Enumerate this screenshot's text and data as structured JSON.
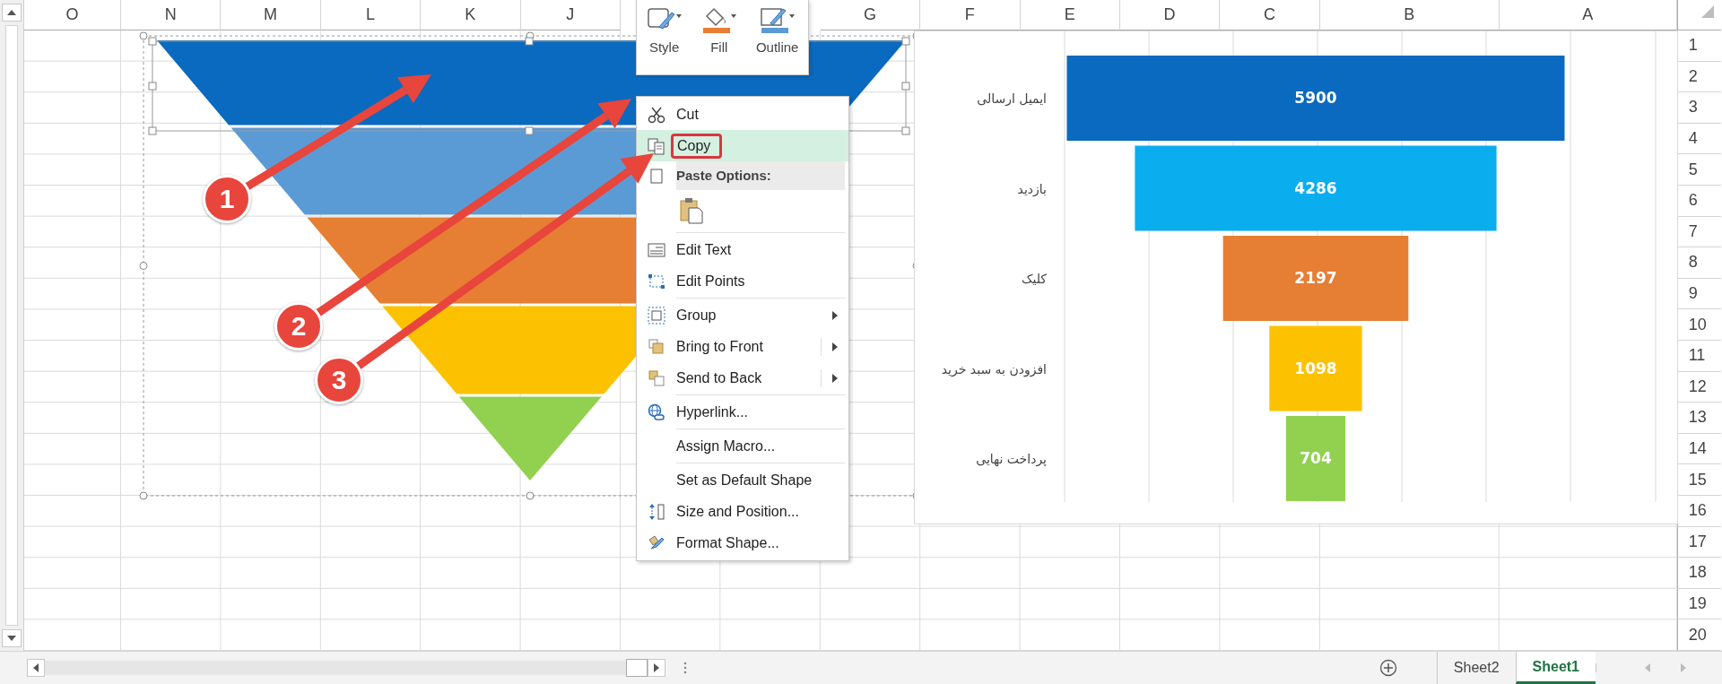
{
  "column_headers": [
    "O",
    "N",
    "M",
    "L",
    "K",
    "J",
    "G",
    "F",
    "E",
    "D",
    "C",
    "B",
    "A"
  ],
  "row_headers": [
    "1",
    "2",
    "3",
    "4",
    "5",
    "6",
    "7",
    "8",
    "9",
    "10",
    "11",
    "12",
    "13",
    "14",
    "15",
    "16",
    "17",
    "18",
    "19",
    "20"
  ],
  "callouts": [
    {
      "number": "1"
    },
    {
      "number": "2"
    },
    {
      "number": "3"
    }
  ],
  "mini_toolbar": {
    "buttons": [
      {
        "label": "Style"
      },
      {
        "label": "Fill"
      },
      {
        "label": "Outline"
      }
    ]
  },
  "context_menu": {
    "items": [
      {
        "kind": "item",
        "label": "Cut",
        "selected": false
      },
      {
        "kind": "item",
        "label": "Copy",
        "selected": true,
        "annotated": true
      },
      {
        "kind": "header",
        "label": "Paste Options:"
      },
      {
        "kind": "paste_icons"
      },
      {
        "kind": "item",
        "label": "Edit Text",
        "selected": false,
        "separator_before": true
      },
      {
        "kind": "item",
        "label": "Edit Points",
        "selected": false
      },
      {
        "kind": "item",
        "label": "Group",
        "selected": false,
        "separator_before": true,
        "submenu": true
      },
      {
        "kind": "item",
        "label": "Bring to Front",
        "selected": false,
        "submenu": true,
        "split": true
      },
      {
        "kind": "item",
        "label": "Send to Back",
        "selected": false,
        "submenu": true,
        "split": true
      },
      {
        "kind": "item",
        "label": "Hyperlink...",
        "selected": false,
        "separator_before": true
      },
      {
        "kind": "item",
        "label": "Assign Macro...",
        "selected": false,
        "separator_before": true
      },
      {
        "kind": "item",
        "label": "Set as Default Shape",
        "selected": false,
        "separator_before": true
      },
      {
        "kind": "item",
        "label": "Size and Position...",
        "selected": false
      },
      {
        "kind": "item",
        "label": "Format Shape...",
        "selected": false
      }
    ]
  },
  "funnel_chart": {
    "stages": [
      {
        "label": "ایمیل ارسالی",
        "value": "5900",
        "color": "#0a6abf"
      },
      {
        "label": "بازدید",
        "value": "4286",
        "color": "#0aaeef"
      },
      {
        "label": "کلیک",
        "value": "2197",
        "color": "#e67e33"
      },
      {
        "label": "افزودن به سبد خرید",
        "value": "1098",
        "color": "#fcc201"
      },
      {
        "label": "پرداخت نهایی",
        "value": "704",
        "color": "#92d050"
      }
    ]
  },
  "sheet_tabs": [
    {
      "label": "Sheet2",
      "selected": false
    },
    {
      "label": "Sheet1",
      "selected": true
    }
  ]
}
